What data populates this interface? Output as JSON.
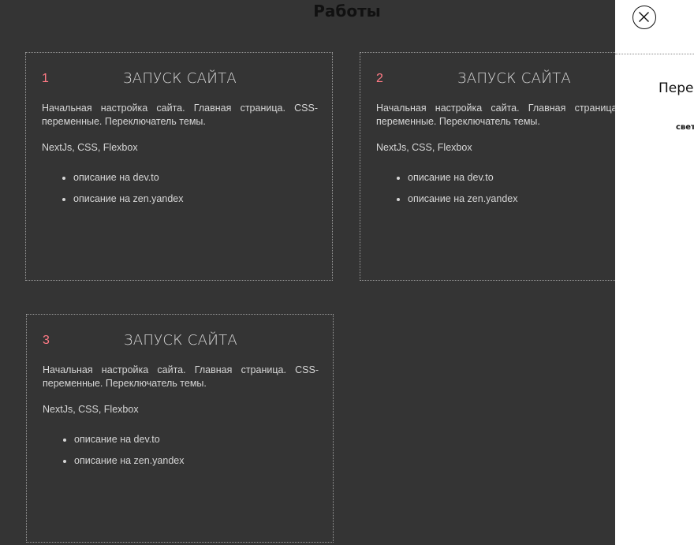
{
  "page": {
    "title": "Работы"
  },
  "cards": [
    {
      "number": "1",
      "title": "ЗАПУСК САЙТА",
      "description": "Начальная настройка сайта. Главная страница. CSS-переменные. Переключатель темы.",
      "stack": "NextJs, CSS, Flexbox",
      "links": [
        "описание на dev.to",
        "описание на zen.yandex"
      ]
    },
    {
      "number": "2",
      "title": "ЗАПУСК САЙТА",
      "description": "Начальная настройка сайта. Главная страница. CSS-переменные. Переключатель темы.",
      "stack": "NextJs, CSS, Flexbox",
      "links": [
        "описание на dev.to",
        "описание на zen.yandex"
      ]
    },
    {
      "number": "3",
      "title": "ЗАПУСК САЙТА",
      "description": "Начальная настройка сайта. Главная страница. CSS-переменные. Переключатель темы.",
      "stack": "NextJs, CSS, Flexbox",
      "links": [
        "описание на dev.to",
        "описание на zen.yandex"
      ]
    }
  ],
  "side_panel": {
    "close_icon": "close-icon",
    "heading": "Пере",
    "option": "свет"
  },
  "colors": {
    "background": "#343434",
    "accent_number": "#ff7a85",
    "panel_background": "#ffffff"
  }
}
